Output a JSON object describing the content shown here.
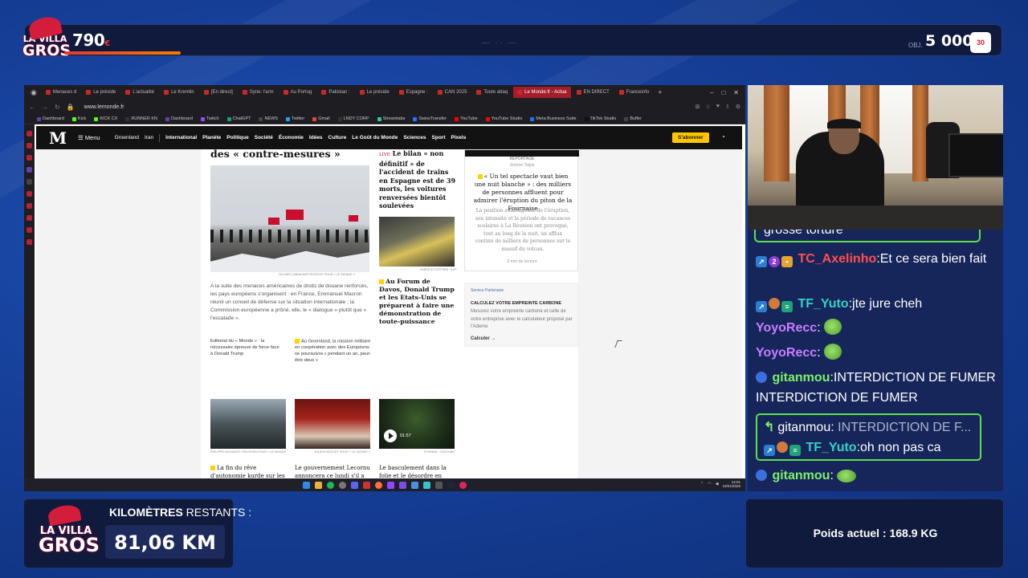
{
  "overlay": {
    "top_bar": {
      "logo_line1": "LA VILLA",
      "logo_line2": "GROS",
      "current_value": "790",
      "current_unit": "€",
      "middle_text": "— ·· —",
      "goal_label": "OBJ.",
      "goal_value": "5 000",
      "goal_unit": "€",
      "progress_percent": 12
    },
    "km_panel": {
      "logo_line1": "LA VILLA",
      "logo_line2": "GROS",
      "label_bold": "KILOMÈTRES",
      "label_thin": " RESTANTS :",
      "value": "81,06 KM"
    },
    "weight_panel": {
      "text": "Poids actuel : 168.9 KG"
    }
  },
  "browser": {
    "tabs": [
      {
        "label": "Menaces d",
        "active": false
      },
      {
        "label": "Le préside",
        "active": false
      },
      {
        "label": "L'actualité",
        "active": false
      },
      {
        "label": "Le Kremlin",
        "active": false
      },
      {
        "label": "[En direct]",
        "active": false
      },
      {
        "label": "Syrie: l'arm",
        "active": false
      },
      {
        "label": "Au Portug",
        "active": false
      },
      {
        "label": "Pakistan :",
        "active": false
      },
      {
        "label": "Le préside",
        "active": false
      },
      {
        "label": "Espagne :",
        "active": false
      },
      {
        "label": "CAN 2025",
        "active": false
      },
      {
        "label": "Toute attaq",
        "active": false
      },
      {
        "label": "Le Monde.fr - Actua",
        "active": true
      },
      {
        "label": "EN DIRECT",
        "active": false
      },
      {
        "label": "Franceinfo",
        "active": false
      }
    ],
    "url": "www.lemonde.fr",
    "bookmarks": [
      "Dashboard",
      "Kick",
      "KICK CX",
      "RUNNER KN",
      "Dashboard",
      "Twitch",
      "ChatGPT",
      "NEWS",
      "Twitter",
      "Gmail",
      "LNDY CORP",
      "Streamlabs",
      "SwissTransfer",
      "YouTube",
      "YouTube Studio",
      "Meta Business Suite",
      "TikTok Studio",
      "Buffer"
    ],
    "taskbar_time": "14:01",
    "taskbar_date": "19/01/2026"
  },
  "lemonde": {
    "logo": "M",
    "menu_label": "Menu",
    "nav_items": [
      "Groenland",
      "Iran",
      "International",
      "Planète",
      "Politique",
      "Société",
      "Économie",
      "Idées",
      "Culture",
      "Le Goût du Monde",
      "Sciences",
      "Sport",
      "Pixels"
    ],
    "subscribe_label": "S'abonner",
    "main_headline": "des « contre-mesures »",
    "main_credit": "OLIVIER LABAN-MATTEI/MYOP POUR « LE MONDE »",
    "main_lede": "A la suite des menaces américaines de droits de douane renforcés, les pays européens s'organisent : en France, Emmanuel Macron réunit un conseil de défense sur la situation internationale ; la Commission européenne a prôné, elle, le « dialogue » plutôt que « l'escalade ».",
    "sub_link_1": "Editorial du « Monde » : la nécessaire épreuve de force face à Donald Trump",
    "sub_link_2": "Au Groenland, la mission militaire en coopération avec des Européens se poursuivra « pendant un an, peut-être deux »",
    "live_tag": "LIVE",
    "spain_headline": "Le bilan « non définitif » de l'accident de trains en Espagne est de 39 morts, les voitures renversées bientôt soulevées",
    "davos_credit": "FABRICE COFFRINI / AFP",
    "davos_headline": "Au Forum de Davos, Donald Trump et les Etats-Unis se préparent à faire une démonstration de toute-puissance",
    "report": {
      "tag": "REPORTAGE",
      "author": "Jérôme Talpin",
      "title": "« Un tel spectacle vaut bien une nuit blanche » : des milliers de personnes affluent pour admirer l'éruption du piton de la Fournaise",
      "body": "La position avantageuse de l'éruption, son intensité et la période de vacances scolaires à La Réunion ont provoqué, tout au long de la nuit, un afflux continu de milliers de personnes sur le massif du volcan.",
      "read_time": "3 min de lecture"
    },
    "partner": {
      "tag": "Service Partenaire",
      "title": "CALCULEZ VOTRE EMPREINTE CARBONE",
      "body": "Mesurez votre empreinte carbone et celle de votre entreprise avec le calculateur proposé par l'Ademe",
      "cta": "Calculer →"
    },
    "thumbs": [
      {
        "credit": "PHILIPPE WOJAZER / REUTERS POUR « LE MONDE »",
        "headline": "La fin du rêve d'autonomie kurde sur les"
      },
      {
        "credit": "JULIEN MUGUET POUR « LE MONDE »",
        "headline": "Le gouvernement Lecornu annoncera ce lundi s'il a"
      },
      {
        "credit": "ÉTIENNE / YOUTUBE",
        "headline": "Le basculement dans la folie et le désordre en",
        "duration": "01:57"
      }
    ]
  },
  "chat": {
    "prev_text": "grosse torture",
    "messages": [
      {
        "badges": [
          "prime",
          "sub",
          "gift"
        ],
        "name": "TC_Axelinho",
        "name_color": "red",
        "text": "Et ce sera bien fait"
      },
      {
        "badges": [
          "prime",
          "ball",
          "mod"
        ],
        "name": "TF_Yuto",
        "name_color": "teal",
        "text": "jte jure cheh"
      },
      {
        "badges": [],
        "name": "YoyoRecc",
        "name_color": "purple",
        "text": "",
        "emote": "pepe"
      },
      {
        "badges": [],
        "name": "YoyoRecc",
        "name_color": "purple",
        "text": "",
        "emote": "pepe"
      },
      {
        "badges": [
          "globe"
        ],
        "name": "gitanmou",
        "name_color": "green",
        "text": "INTERDICTION DE FUMER INTERDICTION DE FUMER"
      }
    ],
    "reply": {
      "quoted_name": "gitanmou:",
      "quoted_text": "INTERDICTION DE F...",
      "name": "TF_Yuto",
      "text": "oh non pas ca"
    },
    "last": {
      "name": "gitanmou",
      "text": ""
    }
  }
}
